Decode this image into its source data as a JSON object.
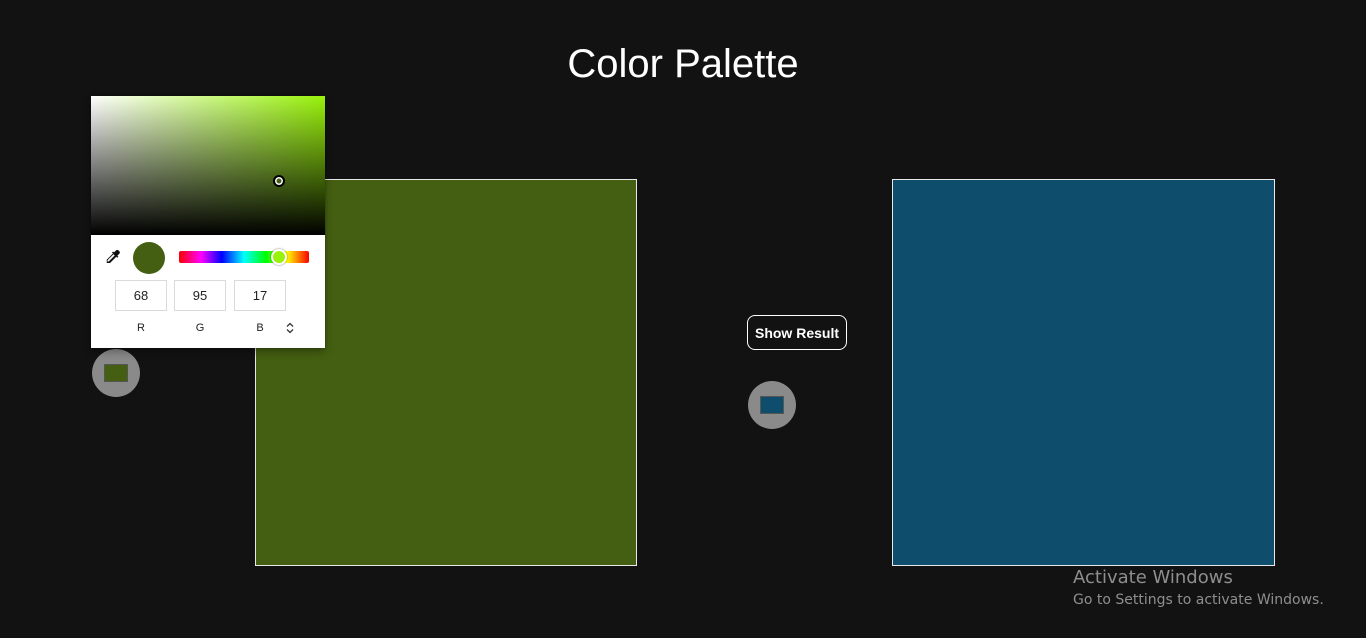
{
  "page": {
    "title": "Color Palette"
  },
  "colors": {
    "background": "#121212",
    "left_swatch": "#445f11",
    "right_swatch": "#0f4d6c",
    "hue_pure": "#99f20b"
  },
  "left_panel": {
    "swatch_color": "#445f11",
    "toggle_icon": "color-chip-icon"
  },
  "right_panel": {
    "swatch_color": "#0f4d6c",
    "toggle_icon": "color-chip-icon"
  },
  "actions": {
    "show_result_label": "Show Result"
  },
  "color_picker": {
    "rgb": {
      "r": "68",
      "g": "95",
      "b": "17"
    },
    "labels": {
      "r": "R",
      "g": "G",
      "b": "B"
    },
    "icons": {
      "eyedropper": "eyedropper-icon",
      "mode_toggle": "up-down-chevron-icon"
    }
  },
  "watermark": {
    "title": "Activate Windows",
    "subtitle": "Go to Settings to activate Windows."
  }
}
